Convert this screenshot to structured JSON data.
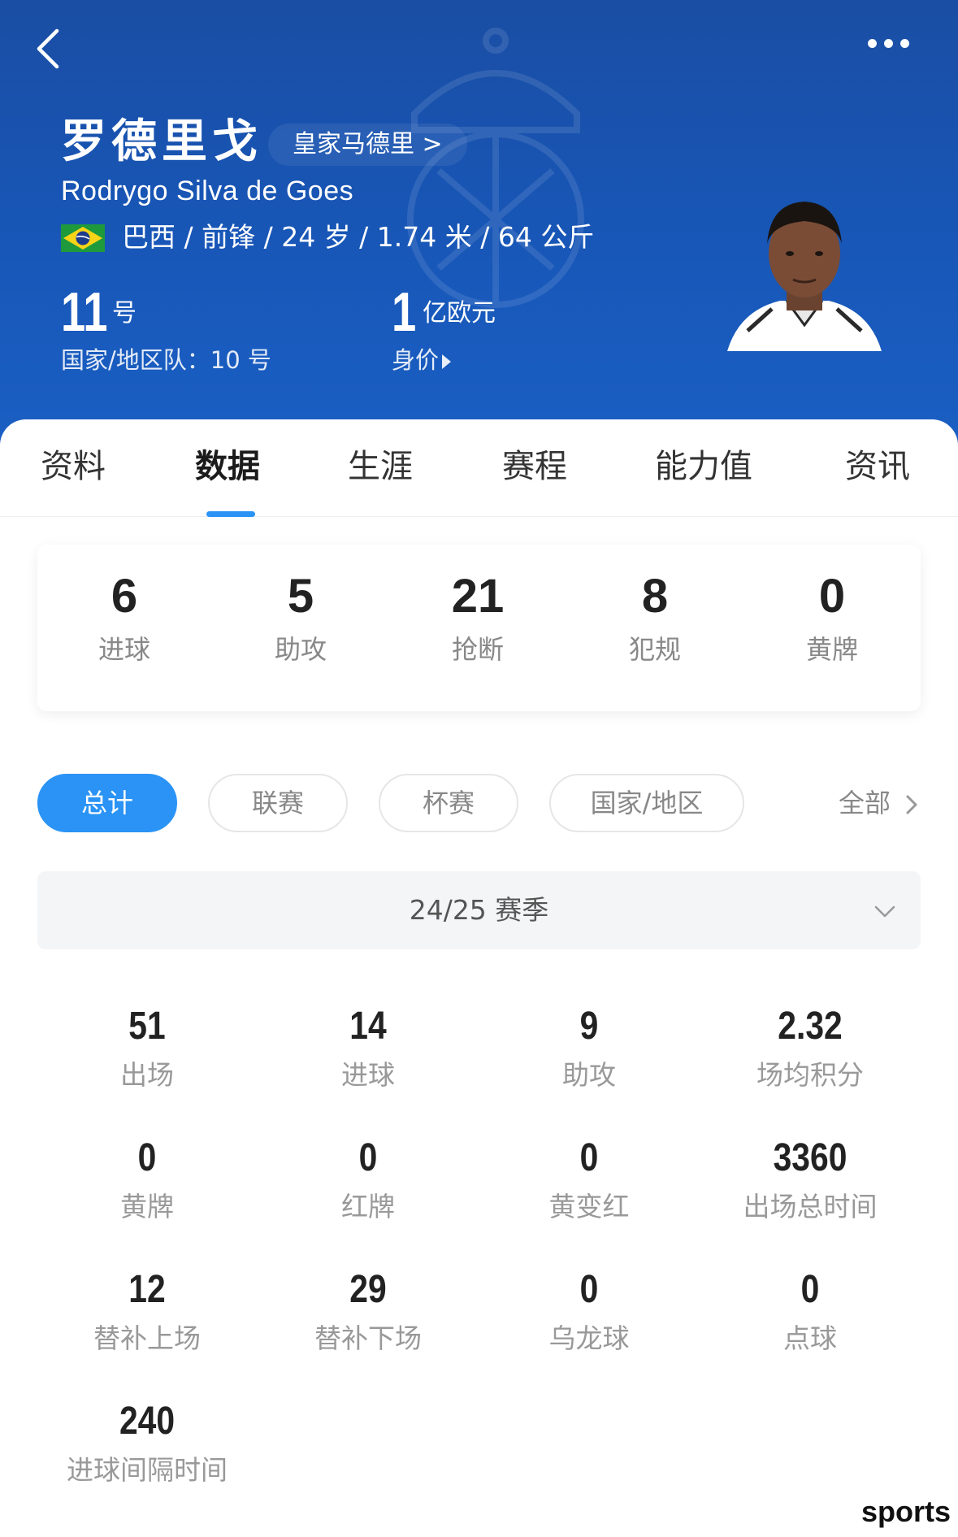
{
  "header": {
    "name_cn": "罗德里戈",
    "team_link": "皇家马德里 >",
    "name_en": "Rodrygo Silva de Goes",
    "info": "巴西 / 前锋 / 24 岁 / 1.74 米 / 64 公斤",
    "flag_icon": "brazil-flag-icon",
    "shirt_number": "11",
    "shirt_unit": "号",
    "national_label": "国家/地区队：10 号",
    "value_number": "1",
    "value_unit": "亿欧元",
    "value_label": "身价"
  },
  "tabs": [
    "资料",
    "数据",
    "生涯",
    "赛程",
    "能力值",
    "资讯"
  ],
  "active_tab": "数据",
  "summary": [
    {
      "value": "6",
      "label": "进球"
    },
    {
      "value": "5",
      "label": "助攻"
    },
    {
      "value": "21",
      "label": "抢断"
    },
    {
      "value": "8",
      "label": "犯规"
    },
    {
      "value": "0",
      "label": "黄牌"
    }
  ],
  "filters": {
    "chips": [
      "总计",
      "联赛",
      "杯赛",
      "国家/地区"
    ],
    "active": "总计",
    "all_label": "全部"
  },
  "season": {
    "label": "24/25 赛季"
  },
  "stats": [
    {
      "value": "51",
      "label": "出场"
    },
    {
      "value": "14",
      "label": "进球"
    },
    {
      "value": "9",
      "label": "助攻"
    },
    {
      "value": "2.32",
      "label": "场均积分"
    },
    {
      "value": "0",
      "label": "黄牌"
    },
    {
      "value": "0",
      "label": "红牌"
    },
    {
      "value": "0",
      "label": "黄变红"
    },
    {
      "value": "3360",
      "label": "出场总时间"
    },
    {
      "value": "12",
      "label": "替补上场"
    },
    {
      "value": "29",
      "label": "替补下场"
    },
    {
      "value": "0",
      "label": "乌龙球"
    },
    {
      "value": "0",
      "label": "点球"
    },
    {
      "value": "240",
      "label": "进球间隔时间"
    }
  ],
  "watermark": "sports",
  "colors": {
    "header_bg": "#1857b8",
    "accent": "#2a93f5",
    "muted_text": "#999999"
  }
}
